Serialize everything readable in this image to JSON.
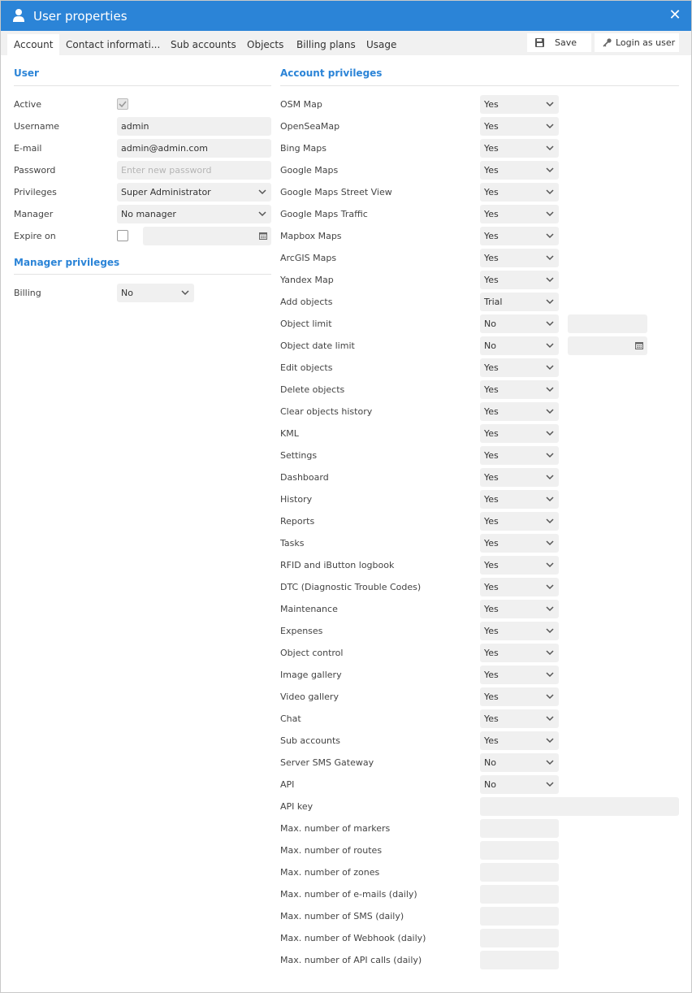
{
  "window": {
    "title": "User properties",
    "icon": "user-icon",
    "close_icon": "close-icon"
  },
  "tabs": [
    "Account",
    "Contact informati...",
    "Sub accounts",
    "Objects",
    "Billing plans",
    "Usage"
  ],
  "toolbar": {
    "save_label": "Save",
    "save_icon": "floppy-disk-icon",
    "login_label": "Login as user",
    "login_icon": "key-icon"
  },
  "user": {
    "section_title": "User",
    "labels": {
      "active": "Active",
      "username": "Username",
      "email": "E-mail",
      "password": "Password",
      "privileges": "Privileges",
      "manager": "Manager",
      "expire_on": "Expire on"
    },
    "active_checked": true,
    "username_value": "admin",
    "email_value": "admin@admin.com",
    "password_placeholder": "Enter new password",
    "privileges_value": "Super Administrator",
    "manager_value": "No manager",
    "expire_checked": false,
    "expire_value": ""
  },
  "manager_privileges": {
    "section_title": "Manager privileges",
    "billing_label": "Billing",
    "billing_value": "No"
  },
  "account_privileges": {
    "section_title": "Account privileges",
    "rows": [
      {
        "label": "OSM Map",
        "value": "Yes"
      },
      {
        "label": "OpenSeaMap",
        "value": "Yes"
      },
      {
        "label": "Bing Maps",
        "value": "Yes"
      },
      {
        "label": "Google Maps",
        "value": "Yes"
      },
      {
        "label": "Google Maps Street View",
        "value": "Yes"
      },
      {
        "label": "Google Maps Traffic",
        "value": "Yes"
      },
      {
        "label": "Mapbox Maps",
        "value": "Yes"
      },
      {
        "label": "ArcGIS Maps",
        "value": "Yes"
      },
      {
        "label": "Yandex Map",
        "value": "Yes"
      },
      {
        "label": "Add objects",
        "value": "Trial"
      },
      {
        "label": "Object limit",
        "value": "No",
        "extra": ""
      },
      {
        "label": "Object date limit",
        "value": "No",
        "extra": "",
        "extra_calendar": true
      },
      {
        "label": "Edit objects",
        "value": "Yes"
      },
      {
        "label": "Delete objects",
        "value": "Yes"
      },
      {
        "label": "Clear objects history",
        "value": "Yes"
      },
      {
        "label": "KML",
        "value": "Yes"
      },
      {
        "label": "Settings",
        "value": "Yes"
      },
      {
        "label": "Dashboard",
        "value": "Yes"
      },
      {
        "label": "History",
        "value": "Yes"
      },
      {
        "label": "Reports",
        "value": "Yes"
      },
      {
        "label": "Tasks",
        "value": "Yes"
      },
      {
        "label": "RFID and iButton logbook",
        "value": "Yes"
      },
      {
        "label": "DTC (Diagnostic Trouble Codes)",
        "value": "Yes"
      },
      {
        "label": "Maintenance",
        "value": "Yes"
      },
      {
        "label": "Expenses",
        "value": "Yes"
      },
      {
        "label": "Object control",
        "value": "Yes"
      },
      {
        "label": "Image gallery",
        "value": "Yes"
      },
      {
        "label": "Video gallery",
        "value": "Yes"
      },
      {
        "label": "Chat",
        "value": "Yes"
      },
      {
        "label": "Sub accounts",
        "value": "Yes"
      },
      {
        "label": "Server SMS Gateway",
        "value": "No"
      },
      {
        "label": "API",
        "value": "No"
      },
      {
        "label": "API key",
        "input": "",
        "wide": true
      },
      {
        "label": "Max. number of markers",
        "input": ""
      },
      {
        "label": "Max. number of routes",
        "input": ""
      },
      {
        "label": "Max. number of zones",
        "input": ""
      },
      {
        "label": "Max. number of e-mails (daily)",
        "input": ""
      },
      {
        "label": "Max. number of SMS (daily)",
        "input": ""
      },
      {
        "label": "Max. number of Webhook (daily)",
        "input": ""
      },
      {
        "label": "Max. number of API calls (daily)",
        "input": ""
      }
    ]
  }
}
